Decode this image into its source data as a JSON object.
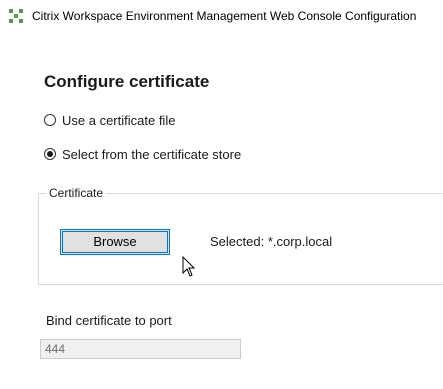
{
  "window": {
    "title": "Citrix Workspace Environment Management Web Console Configuration",
    "icon": "citrix-app-icon",
    "icon_color": "#5a9a3a"
  },
  "main": {
    "heading": "Configure certificate",
    "options": [
      {
        "label": "Use a certificate file",
        "selected": false
      },
      {
        "label": "Select from the certificate store",
        "selected": true
      }
    ]
  },
  "certificate_group": {
    "legend": "Certificate",
    "browse_label": "Browse",
    "selected_text": "Selected: *.corp.local"
  },
  "port": {
    "label": "Bind certificate to port",
    "value": "444",
    "disabled": true
  },
  "colors": {
    "focus_border": "#0078d7",
    "button_bg": "#e1e1e1",
    "disabled_field_bg": "#f0f0f0"
  }
}
